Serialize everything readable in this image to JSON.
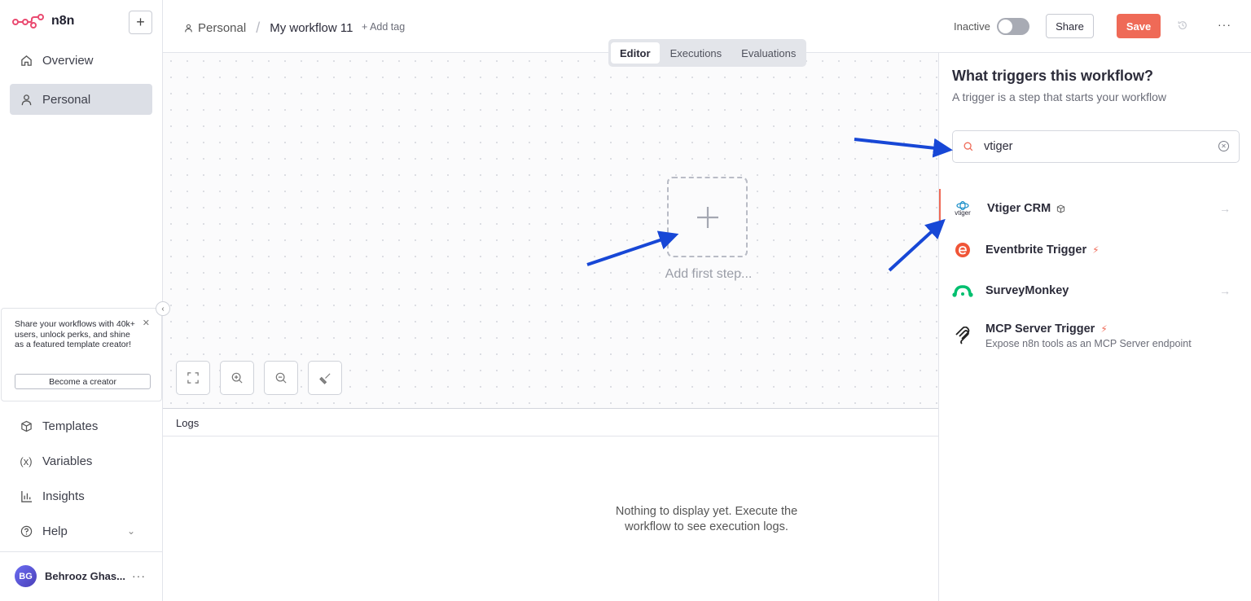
{
  "app": {
    "logo_text": "n8n"
  },
  "sidebar": {
    "new_button": "+",
    "items": [
      {
        "label": "Overview",
        "icon": "home-icon"
      },
      {
        "label": "Personal",
        "icon": "user-icon"
      },
      {
        "label": "Templates",
        "icon": "box-icon"
      },
      {
        "label": "Variables",
        "icon": "variable-icon"
      },
      {
        "label": "Insights",
        "icon": "chart-icon"
      },
      {
        "label": "Help",
        "icon": "help-icon"
      }
    ],
    "promo": {
      "text": "Share your workflows with 40k+ users, unlock perks, and shine as a featured template creator!",
      "button": "Become a creator"
    },
    "user": {
      "initials": "BG",
      "name": "Behrooz Ghas..."
    }
  },
  "header": {
    "breadcrumb_project": "Personal",
    "workflow_name": "My workflow 11",
    "add_tag": "+ Add tag",
    "status_label": "Inactive",
    "share_label": "Share",
    "save_label": "Save"
  },
  "tabs": [
    {
      "label": "Editor",
      "active": true
    },
    {
      "label": "Executions",
      "active": false
    },
    {
      "label": "Evaluations",
      "active": false
    }
  ],
  "canvas": {
    "add_first_step": "Add first step..."
  },
  "logs": {
    "title": "Logs",
    "empty": "Nothing to display yet. Execute the workflow to see execution logs."
  },
  "panel": {
    "title": "What triggers this workflow?",
    "subtitle": "A trigger is a step that starts your workflow",
    "search_value": "vtiger",
    "results": [
      {
        "name": "Vtiger CRM",
        "desc": "",
        "badge": "cube",
        "arrow": true,
        "icon_text": "vtiger"
      },
      {
        "name": "Eventbrite Trigger",
        "desc": "",
        "badge": "bolt",
        "arrow": false
      },
      {
        "name": "SurveyMonkey",
        "desc": "",
        "badge": "",
        "arrow": true
      },
      {
        "name": "MCP Server Trigger",
        "desc": "Expose n8n tools as an MCP Server endpoint",
        "badge": "bolt",
        "arrow": false
      }
    ]
  },
  "colors": {
    "accent": "#ef6a57",
    "arrow": "#1747d6",
    "active_nav": "#dcdfe6"
  }
}
